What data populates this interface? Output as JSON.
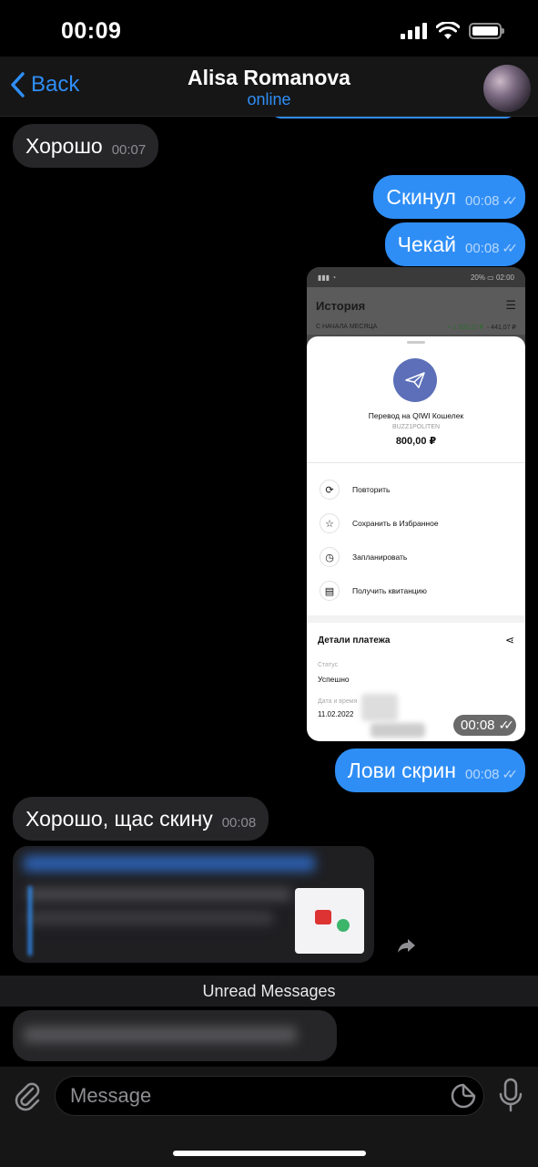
{
  "status_bar": {
    "time": "00:09"
  },
  "header": {
    "back_label": "Back",
    "contact_name": "Alisa Romanova",
    "contact_status": "online"
  },
  "messages": [
    {
      "dir": "in",
      "text": "Хорошо",
      "time": "00:07"
    },
    {
      "dir": "out",
      "text": "Скинул",
      "time": "00:08"
    },
    {
      "dir": "out",
      "text": "Чекай",
      "time": "00:08"
    },
    {
      "dir": "out",
      "text": "Лови скрин",
      "time": "00:08"
    },
    {
      "dir": "in",
      "text": "Хорошо, щас скину",
      "time": "00:08"
    }
  ],
  "screenshot": {
    "time": "00:08",
    "phone_battery": "20%",
    "phone_time": "02:00",
    "screen_title": "История",
    "period_label": "С НАЧАЛА МЕСЯЦА",
    "income": "+ 1 209,22 ₽",
    "expense": "- 441,07 ₽",
    "transfer_title": "Перевод на QIWI Кошелек",
    "recipient": "BUZZ1POLITEN",
    "amount": "800,00 ₽",
    "actions": [
      "Повторить",
      "Сохранить в Избранное",
      "Запланировать",
      "Получить квитанцию"
    ],
    "details_title": "Детали платежа",
    "status_label": "Статус",
    "status_value": "Успешно",
    "date_label": "Дата и время",
    "date_value": "11.02.2022"
  },
  "unread_label": "Unread Messages",
  "composer": {
    "placeholder": "Message"
  },
  "colors": {
    "accent": "#2f8ef6",
    "incoming_bubble": "#262628",
    "background": "#000000"
  }
}
